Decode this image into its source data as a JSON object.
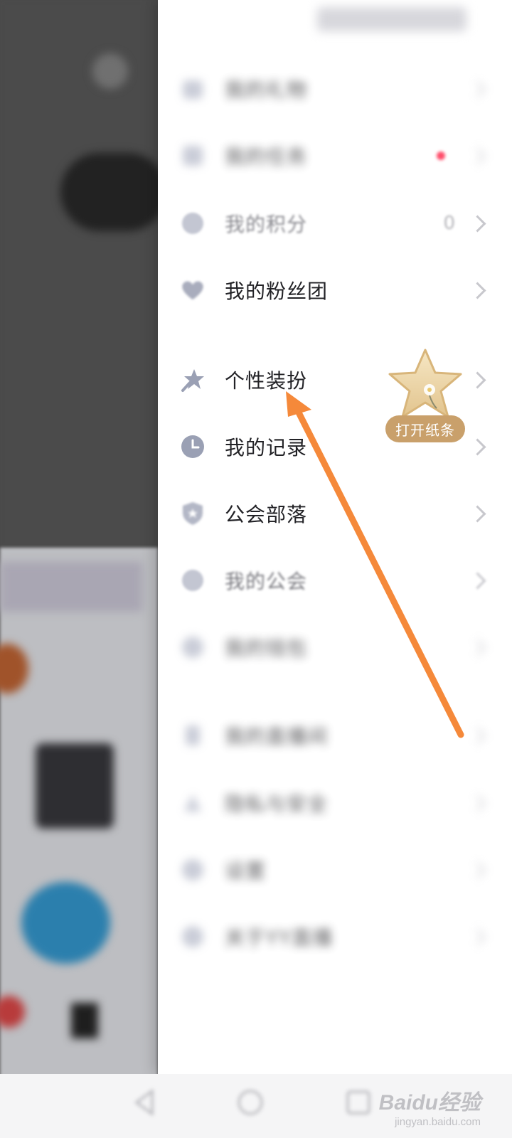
{
  "drawer": {
    "items": [
      {
        "label": "我的礼物",
        "value": "",
        "blurred": true
      },
      {
        "label": "我的任务",
        "value": "",
        "blurred": true
      },
      {
        "label": "我的积分",
        "value": "0",
        "blurred": false,
        "faded": true
      },
      {
        "label": "我的粉丝团",
        "value": "",
        "blurred": false
      },
      {
        "label": "个性装扮",
        "value": "",
        "blurred": false
      },
      {
        "label": "我的记录",
        "value": "",
        "blurred": false
      },
      {
        "label": "公会部落",
        "value": "",
        "blurred": false
      },
      {
        "label": "我的公会",
        "value": "",
        "blurred": false,
        "faded": true
      },
      {
        "label": "我的钱包",
        "value": "",
        "blurred": true
      },
      {
        "label": "我的直播间",
        "value": "",
        "blurred": true
      },
      {
        "label": "隐私与安全",
        "value": "",
        "blurred": true
      },
      {
        "label": "设置",
        "value": "",
        "blurred": true
      },
      {
        "label": "关于YY直播",
        "value": "",
        "blurred": true
      }
    ]
  },
  "badge": {
    "tag": "打开纸条",
    "icon": "star-icon"
  },
  "annotation": {
    "arrow_color": "#f5893a"
  },
  "watermark": {
    "main": "Baidu经验",
    "sub": "jingyan.baidu.com"
  },
  "colors": {
    "text": "#222226",
    "chevron": "#c8c8cd",
    "icon": "#b8bccb",
    "badge": "#c9a06b"
  }
}
